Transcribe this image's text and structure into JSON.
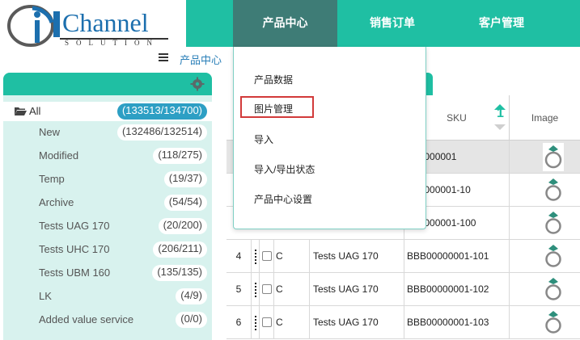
{
  "brand": {
    "logo_word": "Channel",
    "logo_sub": "SOLUTION"
  },
  "topnav": [
    {
      "label": "产品中心",
      "active": true
    },
    {
      "label": "销售订单",
      "active": false
    },
    {
      "label": "客户管理",
      "active": false
    }
  ],
  "breadcrumb": {
    "current": "产品中心"
  },
  "dropdown": {
    "items": [
      {
        "label": "产品数据"
      },
      {
        "label": "图片管理",
        "highlighted": true
      },
      {
        "label": "导入"
      },
      {
        "label": "导入/导出状态"
      },
      {
        "label": "产品中心设置"
      }
    ]
  },
  "tree": {
    "all": {
      "label": "All",
      "count": "(133513/134700)"
    },
    "items": [
      {
        "label": "New",
        "count": "(132486/132514)"
      },
      {
        "label": "Modified",
        "count": "(118/275)"
      },
      {
        "label": "Temp",
        "count": "(19/37)"
      },
      {
        "label": "Archive",
        "count": "(54/54)"
      },
      {
        "label": "Tests UAG 170",
        "count": "(20/200)"
      },
      {
        "label": "Tests UHC 170",
        "count": "(206/211)"
      },
      {
        "label": "Tests UBM 160",
        "count": "(135/135)"
      },
      {
        "label": "LK",
        "count": "(4/9)"
      },
      {
        "label": "Added value service",
        "count": "(0/0)"
      }
    ]
  },
  "grid": {
    "columns": {
      "sku": "SKU",
      "sort_badge": "1",
      "image": "Image"
    },
    "rows": [
      {
        "num": "",
        "c": "",
        "name": "",
        "sku": "B00000001",
        "selected": true
      },
      {
        "num": "",
        "c": "",
        "name": "",
        "sku": "B00000001-10",
        "selected": false
      },
      {
        "num": "",
        "c": "",
        "name": "",
        "sku": "B00000001-100",
        "selected": false
      },
      {
        "num": "4",
        "c": "C",
        "name": "Tests UAG 170",
        "sku": "BBB00000001-101",
        "selected": false
      },
      {
        "num": "5",
        "c": "C",
        "name": "Tests UAG 170",
        "sku": "BBB00000001-102",
        "selected": false
      },
      {
        "num": "6",
        "c": "C",
        "name": "Tests UAG 170",
        "sku": "BBB00000001-103",
        "selected": false
      }
    ]
  },
  "colors": {
    "accent": "#1fbfa3",
    "nav_active": "#3e7c76",
    "panel_bg": "#d8f2ee",
    "badge_blue": "#2d9fc4",
    "highlight_red": "#d23a3a"
  }
}
